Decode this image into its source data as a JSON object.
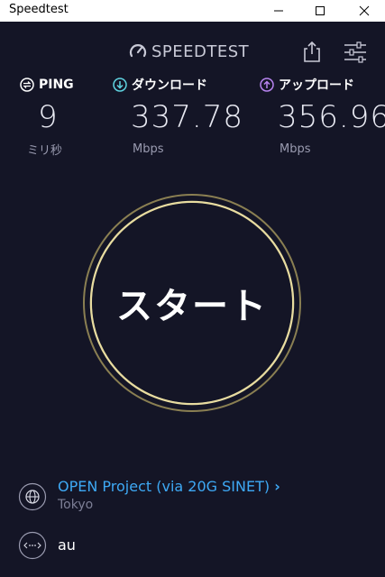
{
  "window": {
    "title": "Speedtest",
    "controls": [
      "minimize",
      "maximize",
      "close"
    ]
  },
  "header": {
    "logo_text": "SPEEDTEST",
    "icons": [
      "gauge-logo-icon",
      "share-icon",
      "settings-sliders-icon"
    ]
  },
  "metrics": {
    "ping": {
      "label": "PING",
      "value": "9",
      "unit": "ミリ秒",
      "icon": "ping-icon"
    },
    "download": {
      "label": "ダウンロード",
      "value": "337.78",
      "unit": "Mbps",
      "icon": "download-arrow-icon"
    },
    "upload": {
      "label": "アップロード",
      "value": "356.96",
      "unit": "Mbps",
      "icon": "upload-arrow-icon"
    }
  },
  "start_button": {
    "label": "スタート"
  },
  "server": {
    "name": "OPEN Project (via 20G SINET)",
    "chevron": "›",
    "location": "Tokyo",
    "icon": "globe-icon"
  },
  "isp": {
    "name": "au",
    "icon": "connection-icon"
  },
  "colors": {
    "background": "#141526",
    "accent_blue": "#3ea9f5",
    "download_teal": "#5fd3e0",
    "upload_purple": "#b884f0",
    "ring_gold": "#d6c884"
  }
}
